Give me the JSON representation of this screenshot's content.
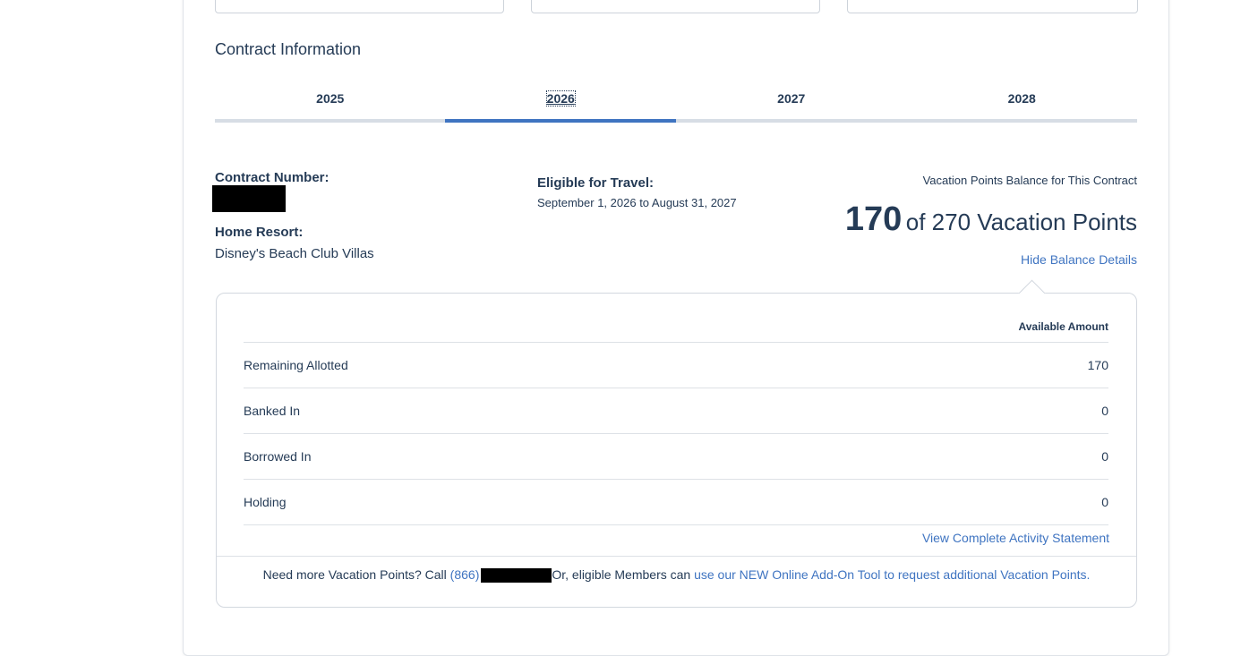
{
  "section_title": "Contract Information",
  "tabs": [
    {
      "label": "2025"
    },
    {
      "label": "2026",
      "active": true
    },
    {
      "label": "2027"
    },
    {
      "label": "2028"
    }
  ],
  "contract": {
    "number_label": "Contract Number:",
    "home_resort_label": "Home Resort:",
    "home_resort_value": "Disney's Beach Club Villas",
    "eligible_label": "Eligible for Travel:",
    "eligible_value": "September 1, 2026 to August 31, 2027"
  },
  "balance": {
    "caption": "Vacation Points Balance for This Contract",
    "current": "170",
    "of_text": "of 270 Vacation Points",
    "toggle_link": "Hide Balance Details"
  },
  "details": {
    "column_header": "Available Amount",
    "rows": [
      {
        "label": "Remaining Allotted",
        "value": "170"
      },
      {
        "label": "Banked In",
        "value": "0"
      },
      {
        "label": "Borrowed In",
        "value": "0"
      },
      {
        "label": "Holding",
        "value": "0"
      }
    ],
    "statement_link": "View Complete Activity Statement"
  },
  "footer": {
    "prefix": "Need more Vacation Points? Call ",
    "phone_area": "(866)",
    "middle": "Or, eligible Members can ",
    "addon_link": "use our NEW Online Add-On Tool to request additional Vacation Points."
  },
  "colors": {
    "text": "#253b56",
    "accent": "#3f74c1",
    "tab_track": "#d7dde5"
  }
}
